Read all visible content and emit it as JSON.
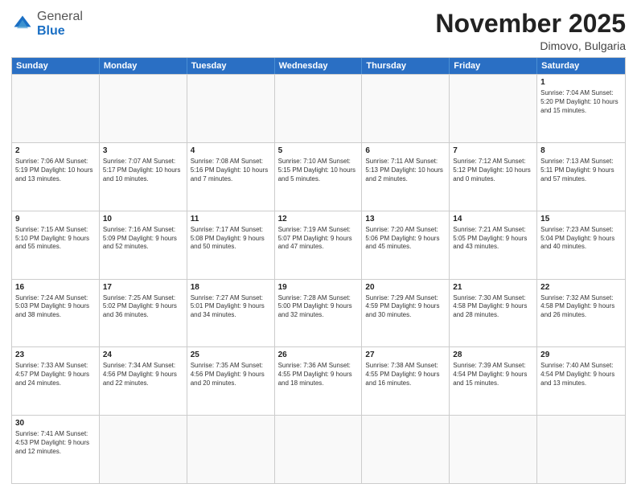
{
  "logo": {
    "general": "General",
    "blue": "Blue"
  },
  "title": "November 2025",
  "subtitle": "Dimovo, Bulgaria",
  "days": [
    "Sunday",
    "Monday",
    "Tuesday",
    "Wednesday",
    "Thursday",
    "Friday",
    "Saturday"
  ],
  "weeks": [
    [
      {
        "day": "",
        "info": ""
      },
      {
        "day": "",
        "info": ""
      },
      {
        "day": "",
        "info": ""
      },
      {
        "day": "",
        "info": ""
      },
      {
        "day": "",
        "info": ""
      },
      {
        "day": "",
        "info": ""
      },
      {
        "day": "1",
        "info": "Sunrise: 7:04 AM\nSunset: 5:20 PM\nDaylight: 10 hours and 15 minutes."
      }
    ],
    [
      {
        "day": "2",
        "info": "Sunrise: 7:06 AM\nSunset: 5:19 PM\nDaylight: 10 hours and 13 minutes."
      },
      {
        "day": "3",
        "info": "Sunrise: 7:07 AM\nSunset: 5:17 PM\nDaylight: 10 hours and 10 minutes."
      },
      {
        "day": "4",
        "info": "Sunrise: 7:08 AM\nSunset: 5:16 PM\nDaylight: 10 hours and 7 minutes."
      },
      {
        "day": "5",
        "info": "Sunrise: 7:10 AM\nSunset: 5:15 PM\nDaylight: 10 hours and 5 minutes."
      },
      {
        "day": "6",
        "info": "Sunrise: 7:11 AM\nSunset: 5:13 PM\nDaylight: 10 hours and 2 minutes."
      },
      {
        "day": "7",
        "info": "Sunrise: 7:12 AM\nSunset: 5:12 PM\nDaylight: 10 hours and 0 minutes."
      },
      {
        "day": "8",
        "info": "Sunrise: 7:13 AM\nSunset: 5:11 PM\nDaylight: 9 hours and 57 minutes."
      }
    ],
    [
      {
        "day": "9",
        "info": "Sunrise: 7:15 AM\nSunset: 5:10 PM\nDaylight: 9 hours and 55 minutes."
      },
      {
        "day": "10",
        "info": "Sunrise: 7:16 AM\nSunset: 5:09 PM\nDaylight: 9 hours and 52 minutes."
      },
      {
        "day": "11",
        "info": "Sunrise: 7:17 AM\nSunset: 5:08 PM\nDaylight: 9 hours and 50 minutes."
      },
      {
        "day": "12",
        "info": "Sunrise: 7:19 AM\nSunset: 5:07 PM\nDaylight: 9 hours and 47 minutes."
      },
      {
        "day": "13",
        "info": "Sunrise: 7:20 AM\nSunset: 5:06 PM\nDaylight: 9 hours and 45 minutes."
      },
      {
        "day": "14",
        "info": "Sunrise: 7:21 AM\nSunset: 5:05 PM\nDaylight: 9 hours and 43 minutes."
      },
      {
        "day": "15",
        "info": "Sunrise: 7:23 AM\nSunset: 5:04 PM\nDaylight: 9 hours and 40 minutes."
      }
    ],
    [
      {
        "day": "16",
        "info": "Sunrise: 7:24 AM\nSunset: 5:03 PM\nDaylight: 9 hours and 38 minutes."
      },
      {
        "day": "17",
        "info": "Sunrise: 7:25 AM\nSunset: 5:02 PM\nDaylight: 9 hours and 36 minutes."
      },
      {
        "day": "18",
        "info": "Sunrise: 7:27 AM\nSunset: 5:01 PM\nDaylight: 9 hours and 34 minutes."
      },
      {
        "day": "19",
        "info": "Sunrise: 7:28 AM\nSunset: 5:00 PM\nDaylight: 9 hours and 32 minutes."
      },
      {
        "day": "20",
        "info": "Sunrise: 7:29 AM\nSunset: 4:59 PM\nDaylight: 9 hours and 30 minutes."
      },
      {
        "day": "21",
        "info": "Sunrise: 7:30 AM\nSunset: 4:58 PM\nDaylight: 9 hours and 28 minutes."
      },
      {
        "day": "22",
        "info": "Sunrise: 7:32 AM\nSunset: 4:58 PM\nDaylight: 9 hours and 26 minutes."
      }
    ],
    [
      {
        "day": "23",
        "info": "Sunrise: 7:33 AM\nSunset: 4:57 PM\nDaylight: 9 hours and 24 minutes."
      },
      {
        "day": "24",
        "info": "Sunrise: 7:34 AM\nSunset: 4:56 PM\nDaylight: 9 hours and 22 minutes."
      },
      {
        "day": "25",
        "info": "Sunrise: 7:35 AM\nSunset: 4:56 PM\nDaylight: 9 hours and 20 minutes."
      },
      {
        "day": "26",
        "info": "Sunrise: 7:36 AM\nSunset: 4:55 PM\nDaylight: 9 hours and 18 minutes."
      },
      {
        "day": "27",
        "info": "Sunrise: 7:38 AM\nSunset: 4:55 PM\nDaylight: 9 hours and 16 minutes."
      },
      {
        "day": "28",
        "info": "Sunrise: 7:39 AM\nSunset: 4:54 PM\nDaylight: 9 hours and 15 minutes."
      },
      {
        "day": "29",
        "info": "Sunrise: 7:40 AM\nSunset: 4:54 PM\nDaylight: 9 hours and 13 minutes."
      }
    ],
    [
      {
        "day": "30",
        "info": "Sunrise: 7:41 AM\nSunset: 4:53 PM\nDaylight: 9 hours and 12 minutes."
      },
      {
        "day": "",
        "info": ""
      },
      {
        "day": "",
        "info": ""
      },
      {
        "day": "",
        "info": ""
      },
      {
        "day": "",
        "info": ""
      },
      {
        "day": "",
        "info": ""
      },
      {
        "day": "",
        "info": ""
      }
    ]
  ]
}
